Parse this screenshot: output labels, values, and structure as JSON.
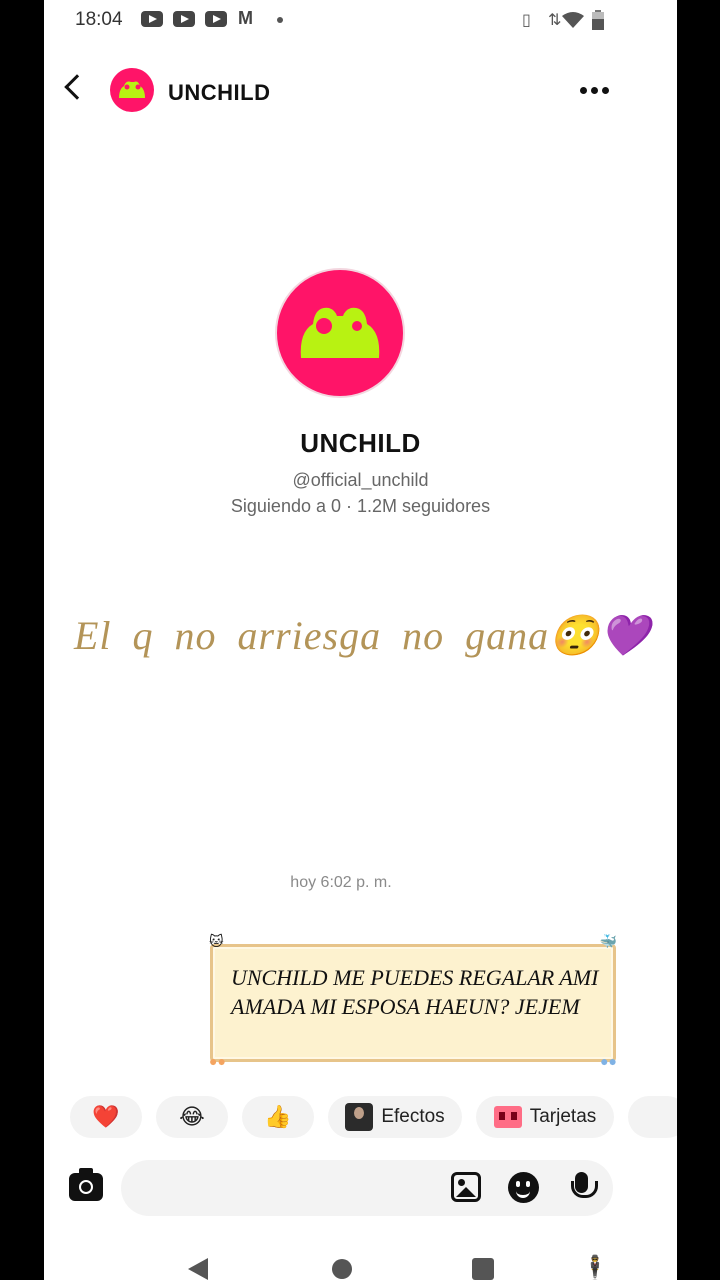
{
  "status_bar": {
    "time": "18:04",
    "notification_icons": [
      "youtube-icon",
      "youtube-icon",
      "youtube-icon",
      "gmail-icon"
    ],
    "system_icons": [
      "vibrate-icon",
      "data-arrows-icon",
      "wifi-icon",
      "battery-icon"
    ]
  },
  "header": {
    "name": "UNCHILD"
  },
  "profile": {
    "name": "UNCHILD",
    "handle": "@official_unchild",
    "stats": "Siguiendo a 0 · 1.2M seguidores"
  },
  "overlay": {
    "caption": "El q no arriesga no gana😳💜"
  },
  "chat": {
    "timestamp": "hoy 6:02 p. m.",
    "message": "UNCHILD ME PUEDES REGALAR AMI AMADA MI ESPOSA HAEUN? JEJEM"
  },
  "quick_replies": {
    "heart": "❤️",
    "laugh": "😂",
    "thumbs": "👍",
    "effects_label": "Efectos",
    "cards_label": "Tarjetas"
  },
  "composer": {
    "placeholder": ""
  },
  "colors": {
    "brand_pink": "#ff1468",
    "brand_lime": "#b8f212",
    "caption_gold": "#b39458",
    "bubble_fill": "#fdf2cf"
  }
}
